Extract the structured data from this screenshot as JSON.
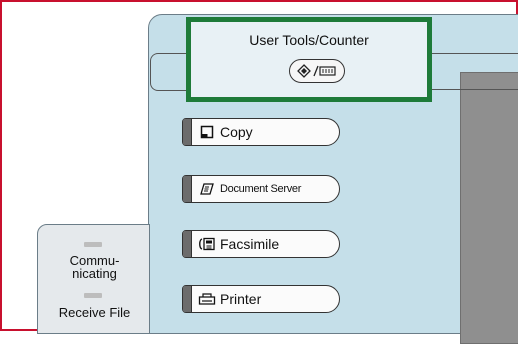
{
  "user_tools": {
    "label": "User Tools/Counter",
    "key_icon": "user-tools-counter-icon",
    "highlight_color": "#1e7b39"
  },
  "buttons": [
    {
      "label": "Copy",
      "icon": "copy-icon"
    },
    {
      "label": "Document Server",
      "icon": "document-server-icon"
    },
    {
      "label": "Facsimile",
      "icon": "facsimile-icon"
    },
    {
      "label": "Printer",
      "icon": "printer-icon"
    }
  ],
  "status": {
    "communicating_label": "Commu-\nnicating",
    "receive_file_label": "Receive File"
  },
  "colors": {
    "frame_border": "#c8102e",
    "panel": "#c5dfe9"
  }
}
